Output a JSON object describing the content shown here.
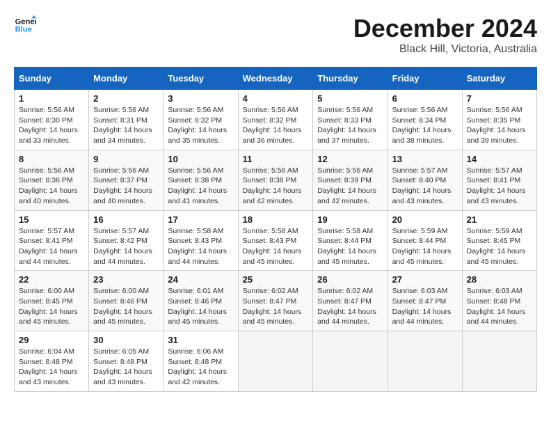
{
  "logo": {
    "line1": "General",
    "line2": "Blue"
  },
  "title": "December 2024",
  "location": "Black Hill, Victoria, Australia",
  "days_of_week": [
    "Sunday",
    "Monday",
    "Tuesday",
    "Wednesday",
    "Thursday",
    "Friday",
    "Saturday"
  ],
  "weeks": [
    [
      {
        "day": "1",
        "sunrise": "5:56 AM",
        "sunset": "8:30 PM",
        "daylight": "14 hours and 33 minutes."
      },
      {
        "day": "2",
        "sunrise": "5:56 AM",
        "sunset": "8:31 PM",
        "daylight": "14 hours and 34 minutes."
      },
      {
        "day": "3",
        "sunrise": "5:56 AM",
        "sunset": "8:32 PM",
        "daylight": "14 hours and 35 minutes."
      },
      {
        "day": "4",
        "sunrise": "5:56 AM",
        "sunset": "8:32 PM",
        "daylight": "14 hours and 36 minutes."
      },
      {
        "day": "5",
        "sunrise": "5:56 AM",
        "sunset": "8:33 PM",
        "daylight": "14 hours and 37 minutes."
      },
      {
        "day": "6",
        "sunrise": "5:56 AM",
        "sunset": "8:34 PM",
        "daylight": "14 hours and 38 minutes."
      },
      {
        "day": "7",
        "sunrise": "5:56 AM",
        "sunset": "8:35 PM",
        "daylight": "14 hours and 39 minutes."
      }
    ],
    [
      {
        "day": "8",
        "sunrise": "5:56 AM",
        "sunset": "8:36 PM",
        "daylight": "14 hours and 40 minutes."
      },
      {
        "day": "9",
        "sunrise": "5:56 AM",
        "sunset": "8:37 PM",
        "daylight": "14 hours and 40 minutes."
      },
      {
        "day": "10",
        "sunrise": "5:56 AM",
        "sunset": "8:38 PM",
        "daylight": "14 hours and 41 minutes."
      },
      {
        "day": "11",
        "sunrise": "5:56 AM",
        "sunset": "8:38 PM",
        "daylight": "14 hours and 42 minutes."
      },
      {
        "day": "12",
        "sunrise": "5:56 AM",
        "sunset": "8:39 PM",
        "daylight": "14 hours and 42 minutes."
      },
      {
        "day": "13",
        "sunrise": "5:57 AM",
        "sunset": "8:40 PM",
        "daylight": "14 hours and 43 minutes."
      },
      {
        "day": "14",
        "sunrise": "5:57 AM",
        "sunset": "8:41 PM",
        "daylight": "14 hours and 43 minutes."
      }
    ],
    [
      {
        "day": "15",
        "sunrise": "5:57 AM",
        "sunset": "8:41 PM",
        "daylight": "14 hours and 44 minutes."
      },
      {
        "day": "16",
        "sunrise": "5:57 AM",
        "sunset": "8:42 PM",
        "daylight": "14 hours and 44 minutes."
      },
      {
        "day": "17",
        "sunrise": "5:58 AM",
        "sunset": "8:43 PM",
        "daylight": "14 hours and 44 minutes."
      },
      {
        "day": "18",
        "sunrise": "5:58 AM",
        "sunset": "8:43 PM",
        "daylight": "14 hours and 45 minutes."
      },
      {
        "day": "19",
        "sunrise": "5:58 AM",
        "sunset": "8:44 PM",
        "daylight": "14 hours and 45 minutes."
      },
      {
        "day": "20",
        "sunrise": "5:59 AM",
        "sunset": "8:44 PM",
        "daylight": "14 hours and 45 minutes."
      },
      {
        "day": "21",
        "sunrise": "5:59 AM",
        "sunset": "8:45 PM",
        "daylight": "14 hours and 45 minutes."
      }
    ],
    [
      {
        "day": "22",
        "sunrise": "6:00 AM",
        "sunset": "8:45 PM",
        "daylight": "14 hours and 45 minutes."
      },
      {
        "day": "23",
        "sunrise": "6:00 AM",
        "sunset": "8:46 PM",
        "daylight": "14 hours and 45 minutes."
      },
      {
        "day": "24",
        "sunrise": "6:01 AM",
        "sunset": "8:46 PM",
        "daylight": "14 hours and 45 minutes."
      },
      {
        "day": "25",
        "sunrise": "6:02 AM",
        "sunset": "8:47 PM",
        "daylight": "14 hours and 45 minutes."
      },
      {
        "day": "26",
        "sunrise": "6:02 AM",
        "sunset": "8:47 PM",
        "daylight": "14 hours and 44 minutes."
      },
      {
        "day": "27",
        "sunrise": "6:03 AM",
        "sunset": "8:47 PM",
        "daylight": "14 hours and 44 minutes."
      },
      {
        "day": "28",
        "sunrise": "6:03 AM",
        "sunset": "8:48 PM",
        "daylight": "14 hours and 44 minutes."
      }
    ],
    [
      {
        "day": "29",
        "sunrise": "6:04 AM",
        "sunset": "8:48 PM",
        "daylight": "14 hours and 43 minutes."
      },
      {
        "day": "30",
        "sunrise": "6:05 AM",
        "sunset": "8:48 PM",
        "daylight": "14 hours and 43 minutes."
      },
      {
        "day": "31",
        "sunrise": "6:06 AM",
        "sunset": "8:48 PM",
        "daylight": "14 hours and 42 minutes."
      },
      null,
      null,
      null,
      null
    ]
  ],
  "labels": {
    "sunrise": "Sunrise:",
    "sunset": "Sunset:",
    "daylight": "Daylight:"
  }
}
